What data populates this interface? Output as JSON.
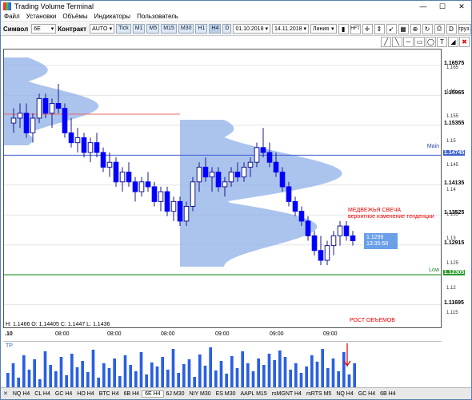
{
  "window": {
    "title": "Trading Volume Terminal",
    "min": "—",
    "max": "☐",
    "close": "✕"
  },
  "menu": [
    "Файл",
    "Установки",
    "Объёмы",
    "Индикаторы",
    "Пользователь"
  ],
  "toolbar": {
    "symbol_label": "Символ",
    "symbol_value": "6E",
    "contract_label": "Контракт",
    "contract_value": "AUTO",
    "timeframes": [
      "Tick",
      "M1",
      "M5",
      "M15",
      "M30",
      "H1",
      "H4",
      "D"
    ],
    "active_timeframe": "H4",
    "date_from": "01.10.2018",
    "date_to": "14.11.2018",
    "chart_style": "Линия",
    "hft": "HFT",
    "load": "груз.",
    "d": "D"
  },
  "price_axis": {
    "levels": [
      "1.16575",
      "1.15965",
      "1.15355",
      "1.14745",
      "1.14135",
      "1.13525",
      "1.12915",
      "1.12305",
      "1.11695"
    ],
    "minor": [
      "1.165",
      "1.16",
      "1.155",
      "1.15",
      "1.145",
      "1.14",
      "1.135",
      "1.13",
      "1.125",
      "1.12",
      "1.115"
    ],
    "main_label": "Main",
    "low_label": "Low"
  },
  "ohlc": "H: 1.1466  O: 1.14405  C: 1.1447  L: 1.1436",
  "cursor": {
    "price": "1.1299",
    "time": "13:35:58"
  },
  "annotations": {
    "bear_title": "МЕДВЕЖЬЯ СВЕЧА",
    "bear_sub": "вероятное изменение тенденции",
    "volume_growth": "РОСТ ОБЪЕМОВ"
  },
  "time_labels": [
    ".10",
    "08:00",
    "08:00",
    "08:00",
    "09:00",
    "09:00",
    "09:00",
    "09:00"
  ],
  "vol_label": "TP",
  "tabs": [
    "NQ H4",
    "CL H4",
    "GC H4",
    "HO H4",
    "BTC H4",
    "6B H4",
    "6E H4",
    "6J M30",
    "NIY M30",
    "ES M30",
    "AAPL M15",
    "rsMGNT H4",
    "rsRTS M5",
    "NQ H4",
    "GC H4",
    "6B H4"
  ],
  "active_tab": "6E H4",
  "colors": {
    "bull": "#1a1ad6",
    "bear": "#0000ff",
    "profile": "#8fb0e8",
    "main": "#3c5fd0",
    "low": "#2a9a2a",
    "accent": "#e00000"
  },
  "chart_data": {
    "type": "candlestick",
    "ylim": [
      1.112,
      1.169
    ],
    "candles": [
      [
        1.154,
        1.157,
        1.152,
        1.155
      ],
      [
        1.155,
        1.158,
        1.153,
        1.156
      ],
      [
        1.156,
        1.158,
        1.151,
        1.152
      ],
      [
        1.152,
        1.156,
        1.15,
        1.155
      ],
      [
        1.155,
        1.16,
        1.154,
        1.159
      ],
      [
        1.159,
        1.16,
        1.155,
        1.156
      ],
      [
        1.156,
        1.159,
        1.153,
        1.158
      ],
      [
        1.158,
        1.162,
        1.156,
        1.157
      ],
      [
        1.157,
        1.158,
        1.151,
        1.152
      ],
      [
        1.152,
        1.155,
        1.149,
        1.15
      ],
      [
        1.15,
        1.153,
        1.148,
        1.151
      ],
      [
        1.151,
        1.152,
        1.147,
        1.148
      ],
      [
        1.148,
        1.151,
        1.146,
        1.15
      ],
      [
        1.15,
        1.152,
        1.147,
        1.148
      ],
      [
        1.148,
        1.149,
        1.144,
        1.145
      ],
      [
        1.145,
        1.148,
        1.143,
        1.146
      ],
      [
        1.146,
        1.147,
        1.141,
        1.142
      ],
      [
        1.142,
        1.145,
        1.14,
        1.144
      ],
      [
        1.144,
        1.146,
        1.141,
        1.142
      ],
      [
        1.142,
        1.143,
        1.138,
        1.14
      ],
      [
        1.14,
        1.143,
        1.139,
        1.142
      ],
      [
        1.142,
        1.144,
        1.14,
        1.141
      ],
      [
        1.141,
        1.142,
        1.137,
        1.138
      ],
      [
        1.138,
        1.141,
        1.136,
        1.14
      ],
      [
        1.14,
        1.141,
        1.135,
        1.136
      ],
      [
        1.136,
        1.139,
        1.134,
        1.138
      ],
      [
        1.138,
        1.139,
        1.133,
        1.134
      ],
      [
        1.134,
        1.138,
        1.133,
        1.137
      ],
      [
        1.137,
        1.143,
        1.136,
        1.142
      ],
      [
        1.142,
        1.146,
        1.14,
        1.145
      ],
      [
        1.145,
        1.147,
        1.142,
        1.143
      ],
      [
        1.143,
        1.145,
        1.14,
        1.144
      ],
      [
        1.144,
        1.145,
        1.14,
        1.141
      ],
      [
        1.141,
        1.143,
        1.139,
        1.142
      ],
      [
        1.142,
        1.145,
        1.141,
        1.144
      ],
      [
        1.144,
        1.146,
        1.142,
        1.143
      ],
      [
        1.143,
        1.146,
        1.142,
        1.145
      ],
      [
        1.145,
        1.147,
        1.143,
        1.146
      ],
      [
        1.146,
        1.15,
        1.145,
        1.149
      ],
      [
        1.149,
        1.153,
        1.147,
        1.148
      ],
      [
        1.148,
        1.15,
        1.145,
        1.146
      ],
      [
        1.146,
        1.148,
        1.143,
        1.144
      ],
      [
        1.144,
        1.145,
        1.14,
        1.141
      ],
      [
        1.141,
        1.142,
        1.137,
        1.138
      ],
      [
        1.138,
        1.139,
        1.135,
        1.136
      ],
      [
        1.136,
        1.137,
        1.133,
        1.134
      ],
      [
        1.134,
        1.135,
        1.13,
        1.131
      ],
      [
        1.131,
        1.132,
        1.127,
        1.128
      ],
      [
        1.128,
        1.131,
        1.125,
        1.126
      ],
      [
        1.126,
        1.13,
        1.125,
        1.129
      ],
      [
        1.129,
        1.132,
        1.127,
        1.131
      ],
      [
        1.131,
        1.134,
        1.129,
        1.133
      ],
      [
        1.133,
        1.134,
        1.13,
        1.131
      ],
      [
        1.131,
        1.132,
        1.129,
        1.13
      ]
    ],
    "volumes": [
      18,
      30,
      12,
      40,
      22,
      35,
      10,
      45,
      28,
      20,
      38,
      15,
      42,
      25,
      33,
      19,
      47,
      12,
      30,
      24,
      36,
      14,
      40,
      28,
      20,
      44,
      16,
      31,
      26,
      38,
      22,
      48,
      18,
      29,
      35,
      13,
      41,
      27,
      50,
      21,
      33,
      17,
      39,
      24,
      45,
      30,
      20,
      36,
      28,
      42,
      34,
      46,
      38,
      22,
      30,
      18,
      26,
      40,
      32,
      48,
      24,
      36,
      20,
      44,
      16,
      30
    ]
  }
}
